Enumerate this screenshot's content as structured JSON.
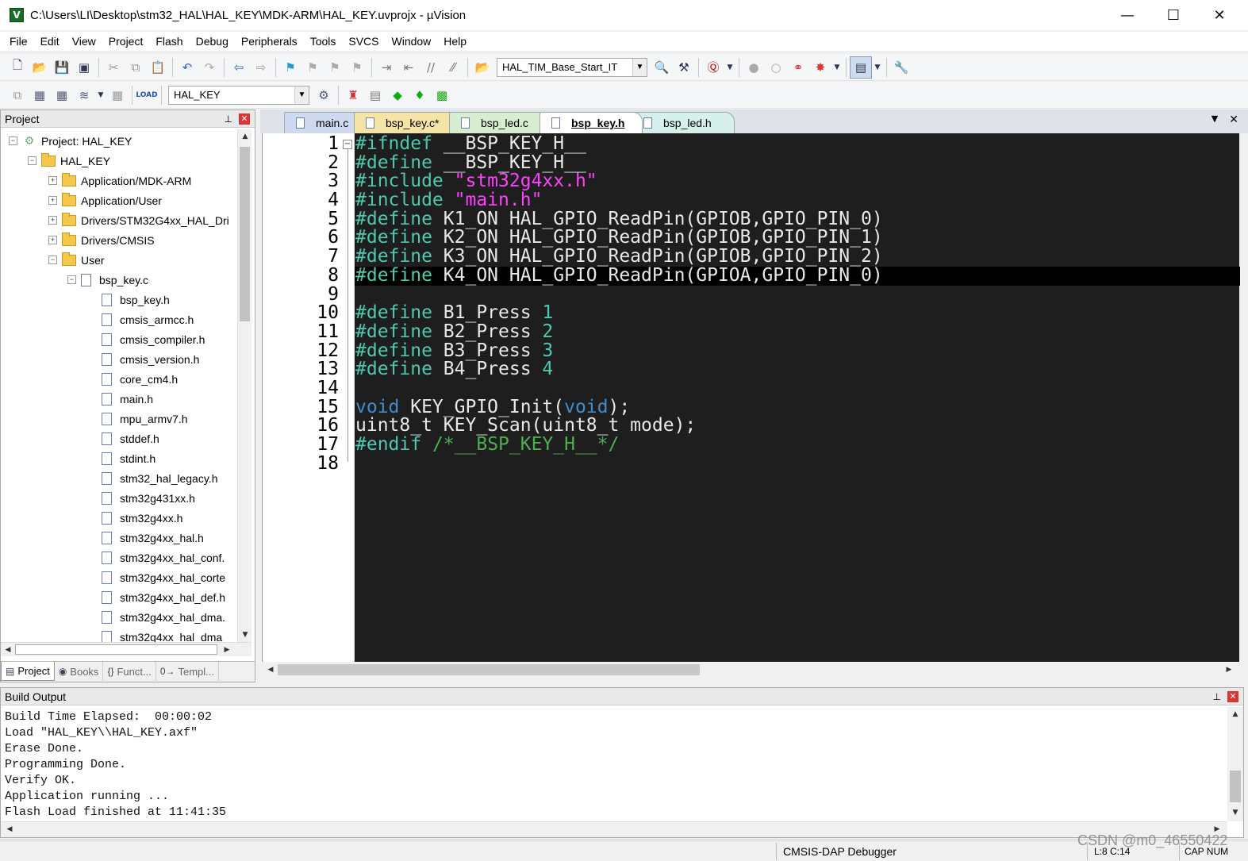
{
  "window": {
    "title": "C:\\Users\\LI\\Desktop\\stm32_HAL\\HAL_KEY\\MDK-ARM\\HAL_KEY.uvprojx - µVision",
    "minimize": "—",
    "maximize": "☐",
    "close": "✕",
    "app_icon": "V"
  },
  "menu": [
    "File",
    "Edit",
    "View",
    "Project",
    "Flash",
    "Debug",
    "Peripherals",
    "Tools",
    "SVCS",
    "Window",
    "Help"
  ],
  "toolbar1": {
    "find_combo_value": "HAL_TIM_Base_Start_IT"
  },
  "toolbar2": {
    "target_combo_value": "HAL_KEY"
  },
  "project_panel": {
    "title": "Project",
    "pin": "⊥",
    "close": "✕",
    "tree": [
      {
        "label": "Project: HAL_KEY",
        "kind": "project",
        "level": 0,
        "expander": "−"
      },
      {
        "label": "HAL_KEY",
        "kind": "folder",
        "level": 1,
        "expander": "−"
      },
      {
        "label": "Application/MDK-ARM",
        "kind": "folder",
        "level": 2,
        "expander": "+"
      },
      {
        "label": "Application/User",
        "kind": "folder",
        "level": 2,
        "expander": "+"
      },
      {
        "label": "Drivers/STM32G4xx_HAL_Dri",
        "kind": "folder",
        "level": 2,
        "expander": "+"
      },
      {
        "label": "Drivers/CMSIS",
        "kind": "folder",
        "level": 2,
        "expander": "+"
      },
      {
        "label": "User",
        "kind": "folder",
        "level": 2,
        "expander": "−"
      },
      {
        "label": "bsp_key.c",
        "kind": "file",
        "level": 3,
        "expander": "−"
      },
      {
        "label": "bsp_key.h",
        "kind": "file",
        "level": 4,
        "expander": ""
      },
      {
        "label": "cmsis_armcc.h",
        "kind": "file",
        "level": 4,
        "expander": ""
      },
      {
        "label": "cmsis_compiler.h",
        "kind": "file",
        "level": 4,
        "expander": ""
      },
      {
        "label": "cmsis_version.h",
        "kind": "file",
        "level": 4,
        "expander": ""
      },
      {
        "label": "core_cm4.h",
        "kind": "file",
        "level": 4,
        "expander": ""
      },
      {
        "label": "main.h",
        "kind": "file",
        "level": 4,
        "expander": ""
      },
      {
        "label": "mpu_armv7.h",
        "kind": "file",
        "level": 4,
        "expander": ""
      },
      {
        "label": "stddef.h",
        "kind": "file",
        "level": 4,
        "expander": ""
      },
      {
        "label": "stdint.h",
        "kind": "file",
        "level": 4,
        "expander": ""
      },
      {
        "label": "stm32_hal_legacy.h",
        "kind": "file",
        "level": 4,
        "expander": ""
      },
      {
        "label": "stm32g431xx.h",
        "kind": "file",
        "level": 4,
        "expander": ""
      },
      {
        "label": "stm32g4xx.h",
        "kind": "file",
        "level": 4,
        "expander": ""
      },
      {
        "label": "stm32g4xx_hal.h",
        "kind": "file",
        "level": 4,
        "expander": ""
      },
      {
        "label": "stm32g4xx_hal_conf.",
        "kind": "file",
        "level": 4,
        "expander": ""
      },
      {
        "label": "stm32g4xx_hal_corte",
        "kind": "file",
        "level": 4,
        "expander": ""
      },
      {
        "label": "stm32g4xx_hal_def.h",
        "kind": "file",
        "level": 4,
        "expander": ""
      },
      {
        "label": "stm32g4xx_hal_dma.",
        "kind": "file",
        "level": 4,
        "expander": ""
      },
      {
        "label": "stm32g4xx_hal_dma",
        "kind": "file",
        "level": 4,
        "expander": ""
      }
    ],
    "tabs": [
      {
        "label": "Project",
        "icon": "▤",
        "active": true
      },
      {
        "label": "Books",
        "icon": "◉",
        "active": false
      },
      {
        "label": "Funct...",
        "icon": "{}",
        "active": false
      },
      {
        "label": "Templ...",
        "icon": "0→",
        "active": false
      }
    ]
  },
  "editor": {
    "tabs": [
      {
        "label": "main.c",
        "color": "#cfd9f0",
        "active": false
      },
      {
        "label": "bsp_key.c*",
        "color": "#f4e4a6",
        "active": false
      },
      {
        "label": "bsp_led.c",
        "color": "#d9edd0",
        "active": false
      },
      {
        "label": "bsp_key.h",
        "color": "#e4dcf2",
        "active": true
      },
      {
        "label": "bsp_led.h",
        "color": "#d6f0ec",
        "active": false
      }
    ],
    "tab_menu": "▼",
    "tab_close": "✕",
    "fold_marker": "−",
    "current_line": 8,
    "lines": [
      [
        {
          "t": "#ifndef",
          "c": "pp"
        },
        {
          "t": " __BSP_KEY_H__",
          "c": ""
        }
      ],
      [
        {
          "t": "#define",
          "c": "pp"
        },
        {
          "t": " __BSP_KEY_H__",
          "c": ""
        }
      ],
      [
        {
          "t": "#include",
          "c": "pp"
        },
        {
          "t": " ",
          "c": ""
        },
        {
          "t": "\"stm32g4xx.h\"",
          "c": "str"
        }
      ],
      [
        {
          "t": "#include",
          "c": "pp"
        },
        {
          "t": " ",
          "c": ""
        },
        {
          "t": "\"main.h\"",
          "c": "str"
        }
      ],
      [
        {
          "t": "#define",
          "c": "pp"
        },
        {
          "t": " K1_ON HAL_GPIO_ReadPin(GPIOB,GPIO_PIN_0)",
          "c": ""
        }
      ],
      [
        {
          "t": "#define",
          "c": "pp"
        },
        {
          "t": " K2_ON HAL_GPIO_ReadPin(GPIOB,GPIO_PIN_1)",
          "c": ""
        }
      ],
      [
        {
          "t": "#define",
          "c": "pp"
        },
        {
          "t": " K3_ON HAL_GPIO_ReadPin(GPIOB,GPIO_PIN_2)",
          "c": ""
        }
      ],
      [
        {
          "t": "#define",
          "c": "pp"
        },
        {
          "t": " K4_ON HAL_GPIO_ReadPin(GPIOA,GPIO_PIN_0)",
          "c": ""
        }
      ],
      [],
      [
        {
          "t": "#define",
          "c": "pp"
        },
        {
          "t": " B1_Press ",
          "c": ""
        },
        {
          "t": "1",
          "c": "num"
        }
      ],
      [
        {
          "t": "#define",
          "c": "pp"
        },
        {
          "t": " B2_Press ",
          "c": ""
        },
        {
          "t": "2",
          "c": "num"
        }
      ],
      [
        {
          "t": "#define",
          "c": "pp"
        },
        {
          "t": " B3_Press ",
          "c": ""
        },
        {
          "t": "3",
          "c": "num"
        }
      ],
      [
        {
          "t": "#define",
          "c": "pp"
        },
        {
          "t": " B4_Press ",
          "c": ""
        },
        {
          "t": "4",
          "c": "num"
        }
      ],
      [],
      [
        {
          "t": "void",
          "c": "kw"
        },
        {
          "t": " KEY_GPIO_Init(",
          "c": ""
        },
        {
          "t": "void",
          "c": "kw"
        },
        {
          "t": ");",
          "c": ""
        }
      ],
      [
        {
          "t": "uint8_t KEY_Scan(uint8_t mode);",
          "c": ""
        }
      ],
      [
        {
          "t": "#endif",
          "c": "pp"
        },
        {
          "t": " ",
          "c": ""
        },
        {
          "t": "/*__BSP_KEY_H__*/",
          "c": "cmt"
        }
      ],
      []
    ]
  },
  "build_output": {
    "title": "Build Output",
    "pin": "⊥",
    "close": "✕",
    "lines": [
      "Build Time Elapsed:  00:00:02",
      "Load \"HAL_KEY\\\\HAL_KEY.axf\"",
      "Erase Done.",
      "Programming Done.",
      "Verify OK.",
      "Application running ...",
      "Flash Load finished at 11:41:35"
    ]
  },
  "status": {
    "debugger": "CMSIS-DAP Debugger",
    "position": "L:8 C:14",
    "caps": "CAP NUM"
  },
  "watermark": "CSDN @m0_46550422"
}
